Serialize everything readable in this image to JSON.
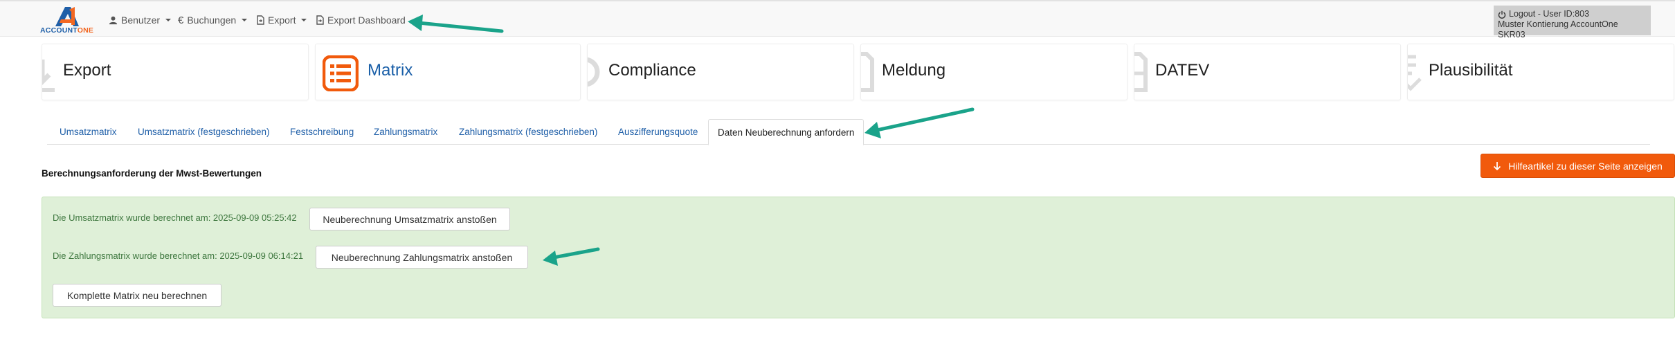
{
  "navbar": {
    "logo": {
      "text_main": "ACCOUNT",
      "text_accent": "ONE"
    },
    "items": [
      {
        "label": "Benutzer",
        "icon": "user-icon",
        "dropdown": true
      },
      {
        "label": "Buchungen",
        "icon": "euro-icon",
        "dropdown": true
      },
      {
        "label": "Export",
        "icon": "file-export-icon",
        "dropdown": true
      },
      {
        "label": "Export Dashboard",
        "icon": "file-export-icon",
        "dropdown": false
      }
    ],
    "user": {
      "logout_label": "Logout - User ID:803",
      "client_name": "Muster Kontierung AccountOne SKR03"
    }
  },
  "modules": [
    {
      "label": "Export",
      "active": false
    },
    {
      "label": "Matrix",
      "active": true
    },
    {
      "label": "Compliance",
      "active": false
    },
    {
      "label": "Meldung",
      "active": false
    },
    {
      "label": "DATEV",
      "active": false
    },
    {
      "label": "Plausibilität",
      "active": false
    }
  ],
  "tabs": [
    {
      "label": "Umsatzmatrix",
      "active": false
    },
    {
      "label": "Umsatzmatrix (festgeschrieben)",
      "active": false
    },
    {
      "label": "Festschreibung",
      "active": false
    },
    {
      "label": "Zahlungsmatrix",
      "active": false
    },
    {
      "label": "Zahlungsmatrix (festgeschrieben)",
      "active": false
    },
    {
      "label": "Auszifferungsquote",
      "active": false
    },
    {
      "label": "Daten Neuberechnung anfordern",
      "active": true
    }
  ],
  "page": {
    "section_title": "Berechnungsanforderung der Mwst-Bewertungen",
    "help_button": "Hilfeartikel zu dieser Seite anzeigen"
  },
  "panel": {
    "umsatz_text": "Die Umsatzmatrix wurde berechnet am: 2025-09-09 05:25:42",
    "umsatz_button": "Neuberechnung Umsatzmatrix anstoßen",
    "zahlung_text": "Die Zahlungsmatrix wurde berechnet am: 2025-09-09 06:14:21",
    "zahlung_button": "Neuberechnung Zahlungsmatrix anstoßen",
    "complete_button": "Komplette Matrix neu berechnen"
  },
  "colors": {
    "brand_blue": "#1f5fa8",
    "brand_orange": "#f26722",
    "help_button": "#f15a0c",
    "success_panel": "#dff0d8",
    "annotation_arrow": "#1aa38a"
  }
}
